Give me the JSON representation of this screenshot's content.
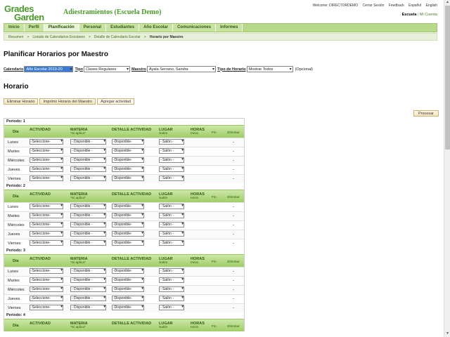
{
  "logo": {
    "line1": "Grades",
    "line2": "Garden"
  },
  "school_title": "Adiestramientos (Escuela Demo)",
  "top_links": [
    "Welcome: DIRECTORDEMO",
    "Cerrar Sesión",
    "Feedback",
    "Español",
    "English"
  ],
  "school_links": {
    "school": "Escuela",
    "sep": "|",
    "account": "Mi Cuenta"
  },
  "nav": [
    "Inicio",
    "Perfil",
    "Planificación",
    "Personal",
    "Estudiantes",
    "Año Escolar",
    "Comunicaciones",
    "Informes"
  ],
  "nav_active": "Planificación",
  "breadcrumb": [
    "Resumen",
    ">",
    "Listado de Calendarios Escolares",
    ">",
    "Detalle de Calendario Escolar",
    ">",
    "Horario por Maestro"
  ],
  "page_title": "Planificar Horarios por Maestro",
  "filters": {
    "calendario_label": "Calendario",
    "calendario_value": "Año Escolar 2019-20",
    "tipo_label": "Tipo",
    "tipo_value": "Clases Regulares",
    "maestro_label": "Maestro",
    "maestro_value": "Ayala Serrano, Sandra",
    "tipo_horario_label": "Tipo de Horario",
    "tipo_horario_value": "Mostrar Todos",
    "optional": "(Opcional)"
  },
  "section_title": "Horario",
  "actions": {
    "delete": "Eliminar Horario",
    "print": "Imprimir Horario del Maestro",
    "add": "Agregar actividad"
  },
  "process_button": "Procesar",
  "table_headers": {
    "dia": "Día",
    "actividad": "ACTIVIDAD",
    "materia": "MATERIA",
    "materia_sub": "*Si aplica*",
    "detalle": "DETALLE ACTIVIDAD",
    "lugar": "LUGAR",
    "lugar_sub": "Salón",
    "horas": "HORAS",
    "inicio": "Inicio",
    "fin": "Fin",
    "eliminar": "Eliminar"
  },
  "select_defaults": {
    "actividad": "-Seleccione-",
    "materia": "- Disponible -",
    "detalle": "-Disponible-",
    "lugar": "- Salón -"
  },
  "delete_mark": "-",
  "periods": [
    {
      "label": "Periodo: 1",
      "days": [
        "Lunes",
        "Martes",
        "Miércoles",
        "Jueves",
        "Viernes"
      ]
    },
    {
      "label": "Periodo: 2",
      "days": [
        "Lunes",
        "Martes",
        "Miércoles",
        "Jueves",
        "Viernes"
      ]
    },
    {
      "label": "Periodo: 3",
      "days": [
        "Lunes",
        "Martes",
        "Miércoles",
        "Jueves",
        "Viernes"
      ]
    },
    {
      "label": "Periodo: 4",
      "days": []
    }
  ]
}
